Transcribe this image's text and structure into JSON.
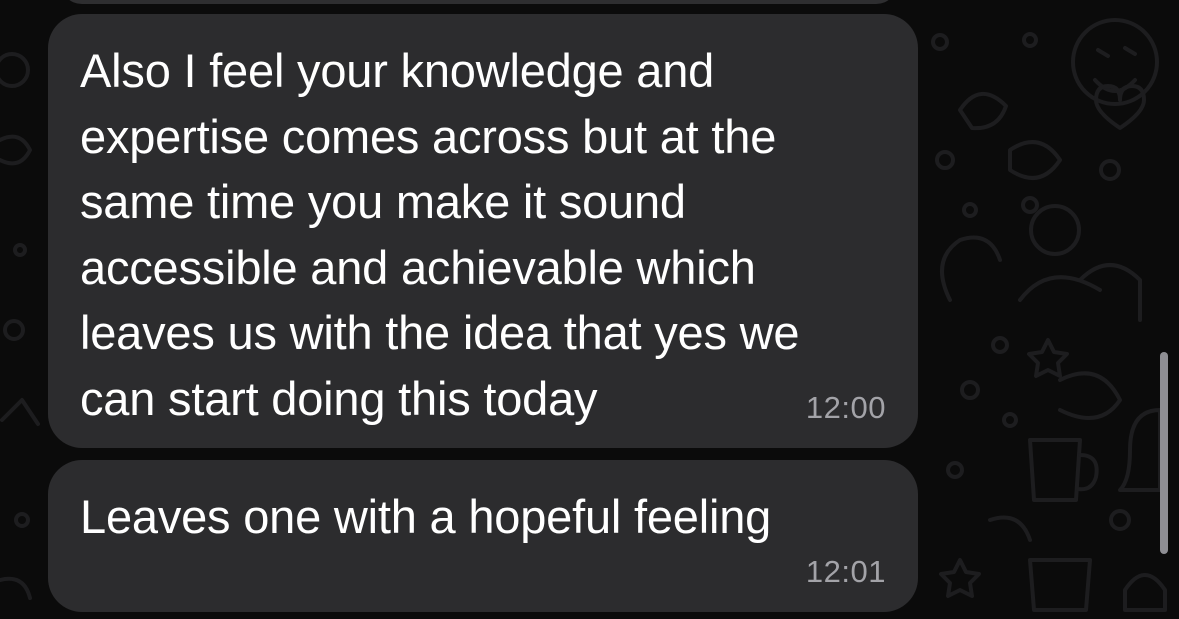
{
  "chat": {
    "messages": [
      {
        "lines": [
          "Also I feel your knowledge and",
          "expertise comes across but at the",
          "same time you make it sound",
          "accessible and achievable which",
          "leaves us with the idea that yes we",
          "can start doing this today"
        ],
        "time": "12:00"
      },
      {
        "lines": [
          "Leaves one with a hopeful feeling"
        ],
        "time": "12:01"
      }
    ]
  },
  "colors": {
    "background": "#0b0b0b",
    "bubble": "#2c2c2e",
    "text": "#ffffff",
    "timestamp": "#a3a3a8",
    "wallpaper_doodle": "#1c1c1e"
  },
  "icons": [
    "doodle-wallpaper-icon",
    "smiley-face-icon",
    "star-icon",
    "heart-icon",
    "mug-icon",
    "bell-icon"
  ]
}
